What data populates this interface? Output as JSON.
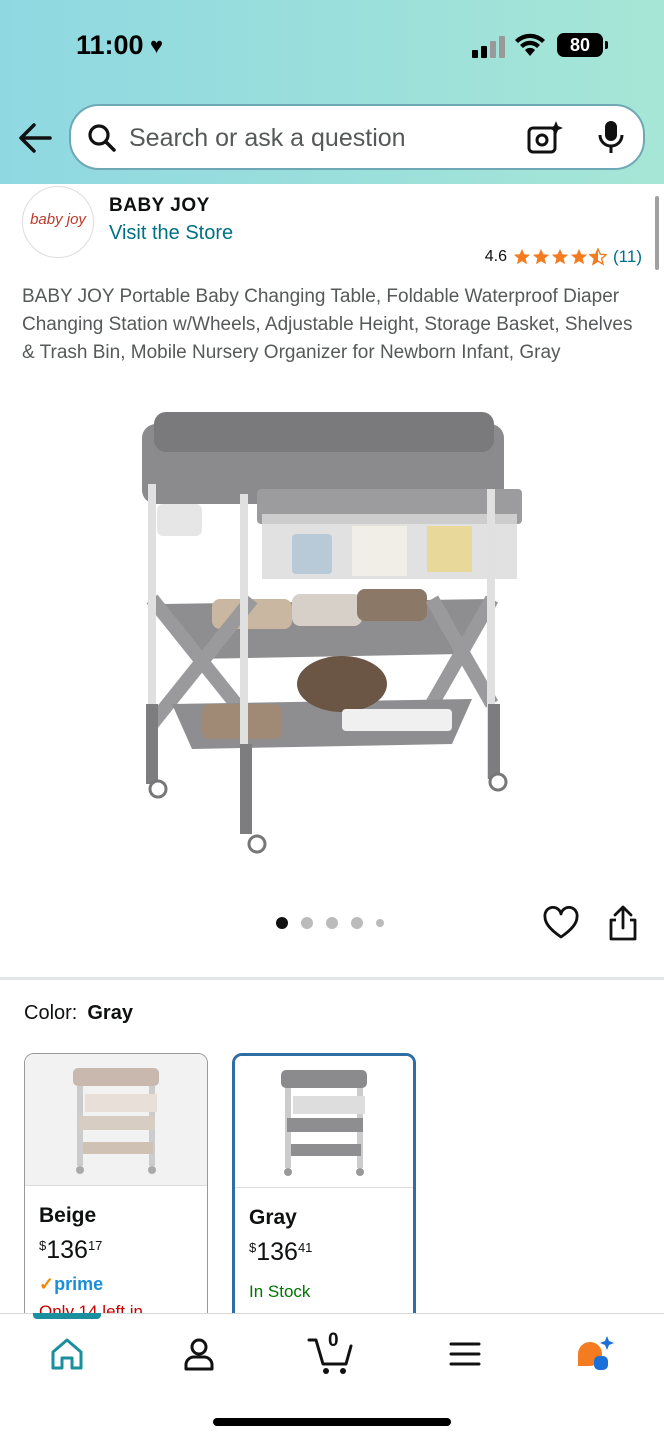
{
  "status_bar": {
    "time": "11:00",
    "battery": "80"
  },
  "search": {
    "placeholder": "Search or ask a question"
  },
  "store": {
    "logo_text": "baby joy",
    "brand": "BABY JOY",
    "visit_label": "Visit the Store"
  },
  "rating": {
    "value": "4.6",
    "count": "(11)",
    "stars_fraction": 0.92
  },
  "product": {
    "title": "BABY JOY Portable Baby Changing Table, Foldable Waterproof Diaper Changing Station w/Wheels, Adjustable Height, Storage Basket, Shelves & Trash Bin, Mobile Nursery Organizer for Newborn Infant, Gray",
    "image_count": 5,
    "active_image": 1
  },
  "color": {
    "label": "Color:",
    "selected": "Gray"
  },
  "variants": [
    {
      "name": "Beige",
      "price_dollars": "136",
      "price_cents": "17",
      "currency": "$",
      "prime": "prime",
      "stock": "Only 14 left in",
      "stock_color": "#c40000"
    },
    {
      "name": "Gray",
      "price_dollars": "136",
      "price_cents": "41",
      "currency": "$",
      "stock": "In Stock",
      "stock_color": "#007600"
    }
  ],
  "nav": {
    "cart_count": "0",
    "items": [
      "home-icon",
      "account-icon",
      "cart-icon",
      "menu-icon",
      "rufus-icon"
    ]
  },
  "colors": {
    "accent": "#007185",
    "star": "#f47b20",
    "nav_active": "#1a8f9d"
  }
}
